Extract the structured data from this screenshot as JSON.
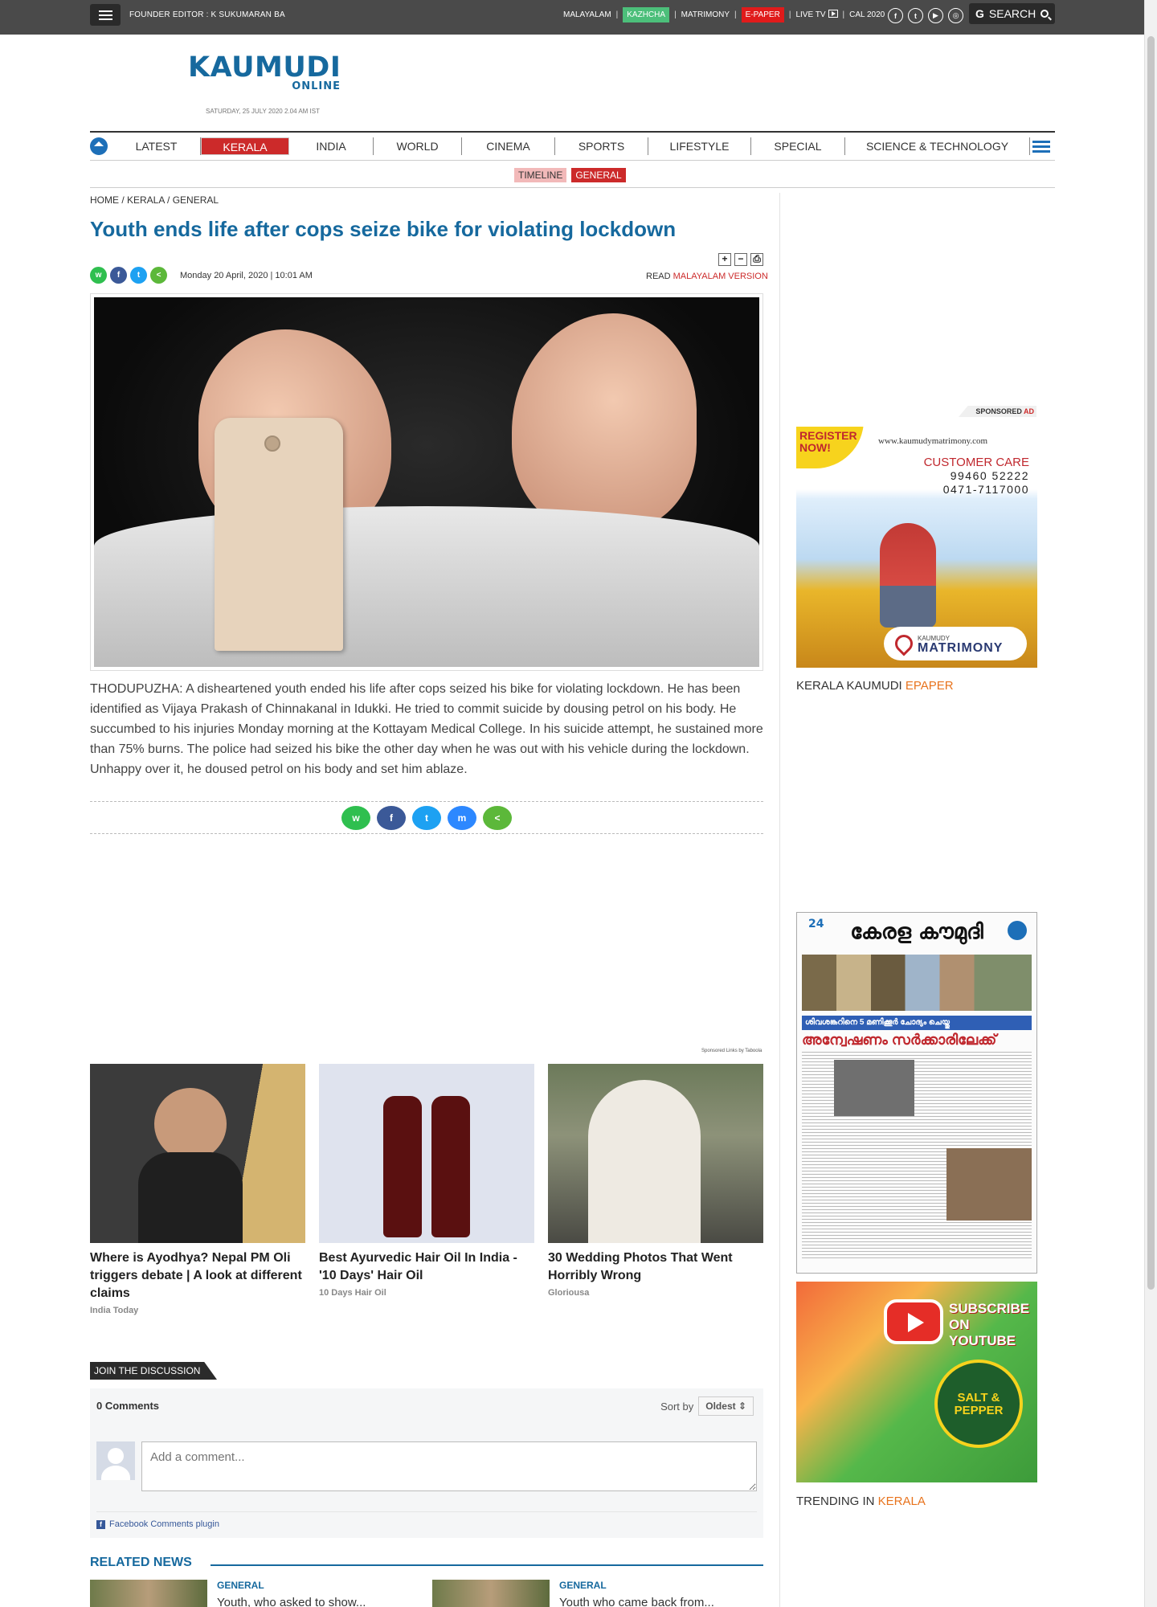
{
  "topbar": {
    "founder": "FOUNDER EDITOR : K SUKUMARAN BA",
    "links": [
      "MALAYALAM",
      "KAZHCHA",
      "MATRIMONY",
      "E-PAPER",
      "LIVE TV",
      "CAL 2020"
    ],
    "search_label": "SEARCH",
    "search_g": "G",
    "social_icons": [
      "facebook-icon",
      "twitter-icon",
      "youtube-icon",
      "instagram-icon"
    ]
  },
  "logo": {
    "title": "KAUMUDI",
    "subtitle": "ONLINE"
  },
  "dateline": "SATURDAY, 25 JULY 2020 2.04 AM IST",
  "nav": {
    "items": [
      "LATEST",
      "KERALA",
      "INDIA",
      "WORLD",
      "CINEMA",
      "SPORTS",
      "LIFESTYLE",
      "SPECIAL",
      "SCIENCE & TECHNOLOGY"
    ],
    "active": "KERALA"
  },
  "subnav": {
    "timeline": "TIMELINE",
    "general": "GENERAL"
  },
  "breadcrumb": "HOME / KERALA / GENERAL",
  "article": {
    "headline": "Youth ends life after cops seize bike for violating lockdown",
    "date": "Monday 20 April, 2020 | 10:01 AM",
    "read_prefix": "READ",
    "read_link": "MALAYALAM VERSION",
    "tools": [
      "+",
      "−",
      "⎙"
    ],
    "body": "THODUPUZHA: A disheartened youth ended his life after cops seized his bike for violating lockdown. He has been identified as Vijaya Prakash of Chinnakanal in Idukki. He tried to commit suicide by dousing petrol on his body. He succumbed to his injuries Monday morning at the Kottayam Medical College. In his suicide attempt, he sustained more than 75% burns. The police had seized his bike the other day when he was out with his vehicle during the lockdown. Unhappy over it, he doused petrol on his body and set him ablaze."
  },
  "sponsored_small": "Sponsored Links  by Taboola",
  "promos": [
    {
      "title": "Where is Ayodhya? Nepal PM Oli triggers debate | A look at different claims",
      "source": "India Today"
    },
    {
      "title": "Best Ayurvedic Hair Oil In India - '10 Days' Hair Oil",
      "source": "10 Days Hair Oil"
    },
    {
      "title": "30 Wedding Photos That Went Horribly Wrong",
      "source": "Gloriousa"
    }
  ],
  "discussion": {
    "join": "JOIN THE DISCUSSION",
    "count": "0 Comments",
    "sort_label": "Sort by",
    "sort_value": "Oldest",
    "placeholder": "Add a comment...",
    "plugin": "Facebook Comments plugin"
  },
  "related": {
    "heading": "RELATED NEWS",
    "items": [
      {
        "category": "GENERAL",
        "title": "Youth, who asked to show..."
      },
      {
        "category": "GENERAL",
        "title": "Youth who came back from..."
      }
    ]
  },
  "sidebar": {
    "sponsored": "SPONSORED",
    "sponsored_ad": "AD",
    "matrimony": {
      "register": "REGISTER NOW!",
      "url": "www.kaumudymatrimony.com",
      "care": "CUSTOMER CARE",
      "phone1": "99460 52222",
      "phone2": "0471-7117000",
      "brand_small": "KAUMUDY",
      "brand": "MATRIMONY"
    },
    "epaper_prefix": "KERALA KAUMUDI",
    "epaper_link": "EPAPER",
    "paper": {
      "masthead": "കേരള കൗമുദി",
      "date_num": "24",
      "strip": "ശിവശങ്കറിനെ 5 മണിക്കൂർ ചോദ്യം ചെയ്തു",
      "lead": "അന്വേഷണം സർക്കാരിലേക്ക്"
    },
    "youtube": {
      "subscribe": "SUBSCRIBE ON YOUTUBE",
      "brand": "SALT & PEPPER"
    },
    "trending_prefix": "TRENDING IN",
    "trending_link": "KERALA"
  },
  "colors": {
    "brand_blue": "#16699e",
    "accent_red": "#cc2a2a",
    "accent_orange": "#e8731d"
  }
}
